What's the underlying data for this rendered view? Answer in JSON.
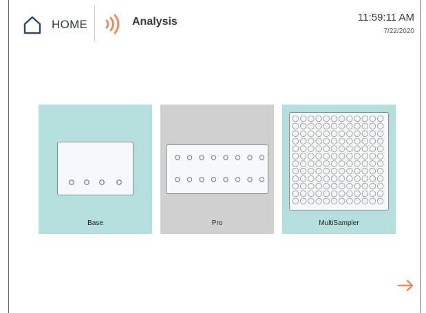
{
  "header": {
    "home_label": "HOME",
    "section_title": "Analysis",
    "time": "11:59:11 AM",
    "date": "7/22/2020"
  },
  "cards": [
    {
      "label": "Base",
      "color": "#b4dfdc"
    },
    {
      "label": "Pro",
      "color": "#d0d0d0"
    },
    {
      "label": "MultiSampler",
      "color": "#b4dfdc"
    }
  ],
  "colors": {
    "accent_orange": "#f08a5d",
    "home_icon": "#2a4a5c",
    "teal_card": "#b4dfdc",
    "gray_card": "#d0d0d0"
  },
  "icons": {
    "home": "home-icon",
    "analysis": "sound-waves-icon",
    "next": "arrow-right-icon"
  }
}
